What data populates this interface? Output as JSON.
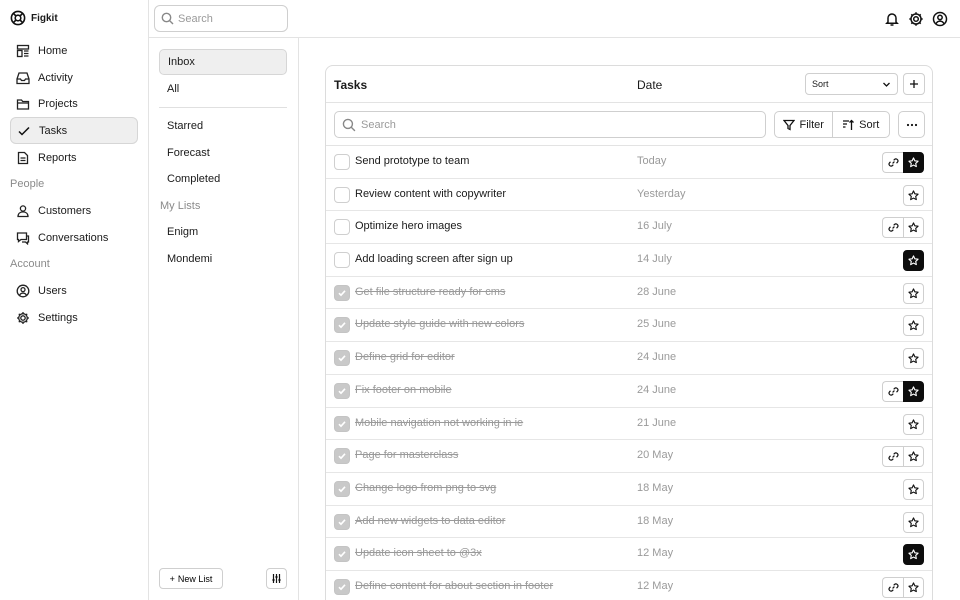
{
  "app": {
    "name": "Figkit"
  },
  "sidebar": {
    "main": [
      {
        "label": "Home",
        "icon": "home-icon"
      },
      {
        "label": "Activity",
        "icon": "inbox-icon"
      },
      {
        "label": "Projects",
        "icon": "folder-icon"
      },
      {
        "label": "Tasks",
        "icon": "check-icon",
        "active": true
      },
      {
        "label": "Reports",
        "icon": "document-icon"
      }
    ],
    "people_title": "People",
    "people": [
      {
        "label": "Customers",
        "icon": "users-icon"
      },
      {
        "label": "Conversations",
        "icon": "chat-icon"
      }
    ],
    "account_title": "Account",
    "account": [
      {
        "label": "Users",
        "icon": "user-circle-icon"
      },
      {
        "label": "Settings",
        "icon": "gear-icon"
      }
    ]
  },
  "topbar": {
    "search_placeholder": "Search"
  },
  "panel": {
    "filters": [
      "Inbox",
      "All"
    ],
    "smart": [
      "Starred",
      "Forecast",
      "Completed"
    ],
    "lists_title": "My Lists",
    "lists": [
      "Enigm",
      "Mondemi"
    ],
    "new_list": "New List"
  },
  "table": {
    "title": "Tasks",
    "date_header": "Date",
    "sort_select": "Sort",
    "search_placeholder": "Search",
    "filter_label": "Filter",
    "sort_label": "Sort",
    "rows": [
      {
        "task": "Send prototype to team",
        "date": "Today",
        "done": false,
        "link": true,
        "starred": true
      },
      {
        "task": "Review content with copywriter",
        "date": "Yesterday",
        "done": false,
        "link": false,
        "starred": false
      },
      {
        "task": "Optimize hero images",
        "date": "16 July",
        "done": false,
        "link": true,
        "starred": false
      },
      {
        "task": "Add loading screen after sign up",
        "date": "14 July",
        "done": false,
        "link": false,
        "starred": true
      },
      {
        "task": "Get file structure ready for cms",
        "date": "28 June",
        "done": true,
        "link": false,
        "starred": false
      },
      {
        "task": "Update style guide with new colors",
        "date": "25 June",
        "done": true,
        "link": false,
        "starred": false
      },
      {
        "task": "Define grid for editor",
        "date": "24 June",
        "done": true,
        "link": false,
        "starred": false
      },
      {
        "task": "Fix footer on mobile",
        "date": "24 June",
        "done": true,
        "link": true,
        "starred": true
      },
      {
        "task": "Mobile navigation not working in ie",
        "date": "21 June",
        "done": true,
        "link": false,
        "starred": false
      },
      {
        "task": "Page for masterclass",
        "date": "20 May",
        "done": true,
        "link": true,
        "starred": false
      },
      {
        "task": "Change logo from png to svg",
        "date": "18 May",
        "done": true,
        "link": false,
        "starred": false
      },
      {
        "task": "Add new widgets to data editor",
        "date": "18 May",
        "done": true,
        "link": false,
        "starred": false
      },
      {
        "task": "Update icon sheet to @3x",
        "date": "12 May",
        "done": true,
        "link": false,
        "starred": true
      },
      {
        "task": "Define content for about section in footer",
        "date": "12 May",
        "done": true,
        "link": true,
        "starred": false
      }
    ]
  }
}
